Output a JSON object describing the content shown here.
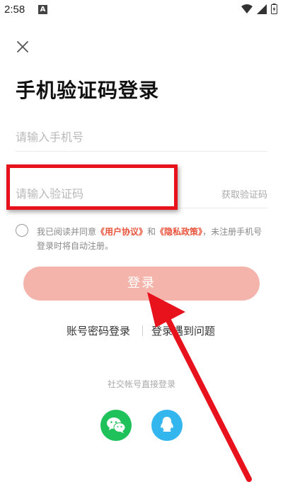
{
  "status": {
    "time": "2:58",
    "notif": "A"
  },
  "title": "手机验证码登录",
  "phone": {
    "placeholder": "请输入手机号",
    "value": ""
  },
  "code": {
    "placeholder": "请输入验证码",
    "value": "",
    "get_code_label": "获取验证码"
  },
  "agreement": {
    "prefix": "我已阅读并同意",
    "user_agreement": "《用户协议》",
    "and": "和",
    "privacy_policy": "《隐私政策》",
    "suffix": "，未注册手机号登录时将自动注册。"
  },
  "login_label": "登录",
  "alt": {
    "password_login": "账号密码登录",
    "problem": "登录遇到问题"
  },
  "social": {
    "label": "社交帐号直接登录",
    "wechat_icon": "wechat-icon",
    "qq_icon": "qq-icon"
  },
  "colors": {
    "accent": "#e8543c",
    "button": "#f4b4ab",
    "highlight": "#e8121c",
    "wechat": "#1fc15a",
    "qq": "#33b5ee"
  }
}
